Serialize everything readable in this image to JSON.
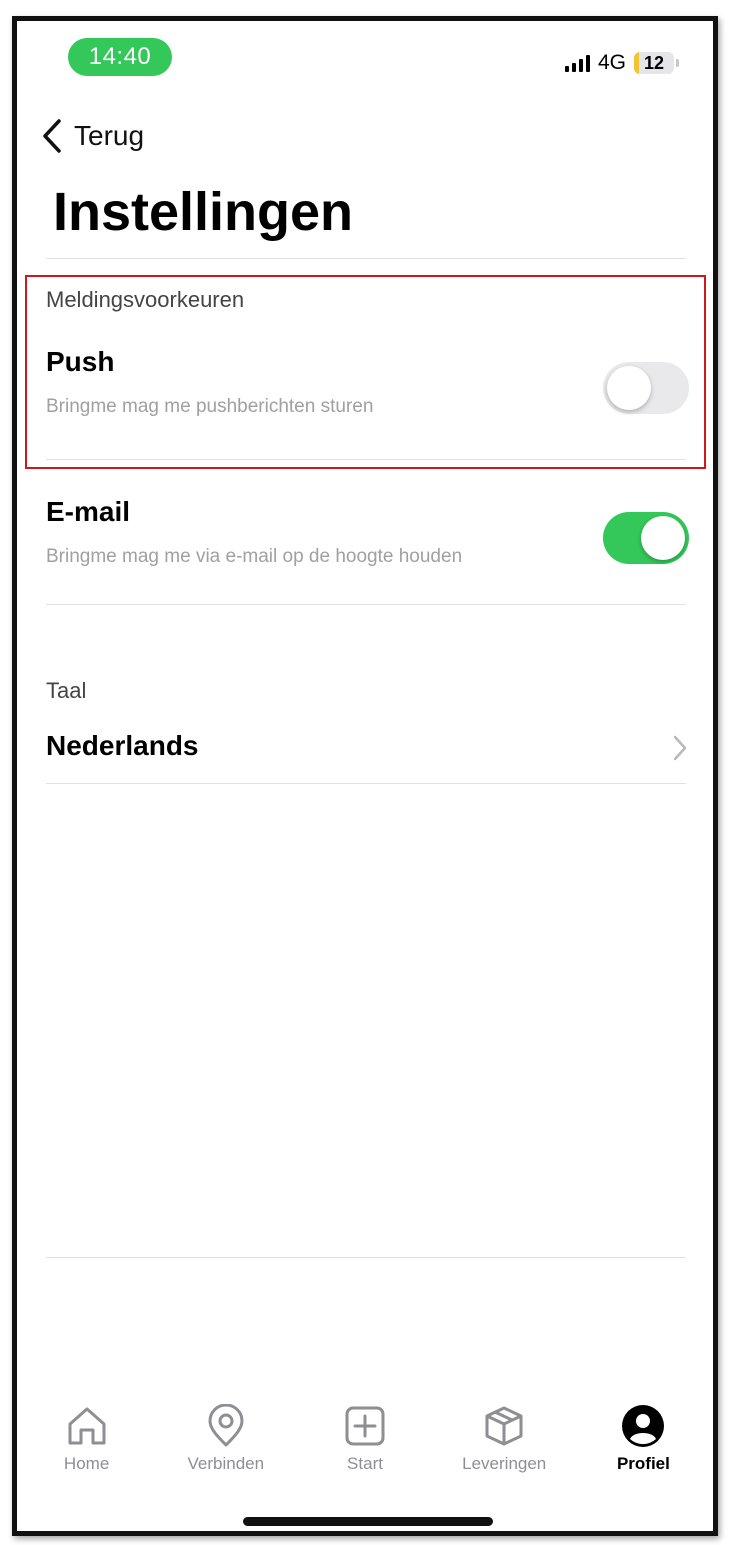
{
  "status_bar": {
    "time": "14:40",
    "network": "4G",
    "battery": "12"
  },
  "nav": {
    "back_label": "Terug"
  },
  "page": {
    "title": "Instellingen"
  },
  "notifications": {
    "section_label": "Meldingsvoorkeuren",
    "push": {
      "title": "Push",
      "subtitle": "Bringme mag me pushberichten sturen",
      "enabled": false
    },
    "email": {
      "title": "E-mail",
      "subtitle": "Bringme mag me via e-mail op de hoogte houden",
      "enabled": true
    }
  },
  "language": {
    "section_label": "Taal",
    "value": "Nederlands"
  },
  "tabbar": {
    "items": [
      {
        "label": "Home",
        "icon": "home-icon"
      },
      {
        "label": "Verbinden",
        "icon": "location-pin-icon"
      },
      {
        "label": "Start",
        "icon": "plus-square-icon"
      },
      {
        "label": "Leveringen",
        "icon": "package-icon"
      },
      {
        "label": "Profiel",
        "icon": "profile-icon"
      }
    ],
    "active": "Profiel"
  },
  "colors": {
    "accent_green": "#34c759",
    "highlight_red": "#d0171e",
    "battery_yellow": "#f4c430"
  }
}
